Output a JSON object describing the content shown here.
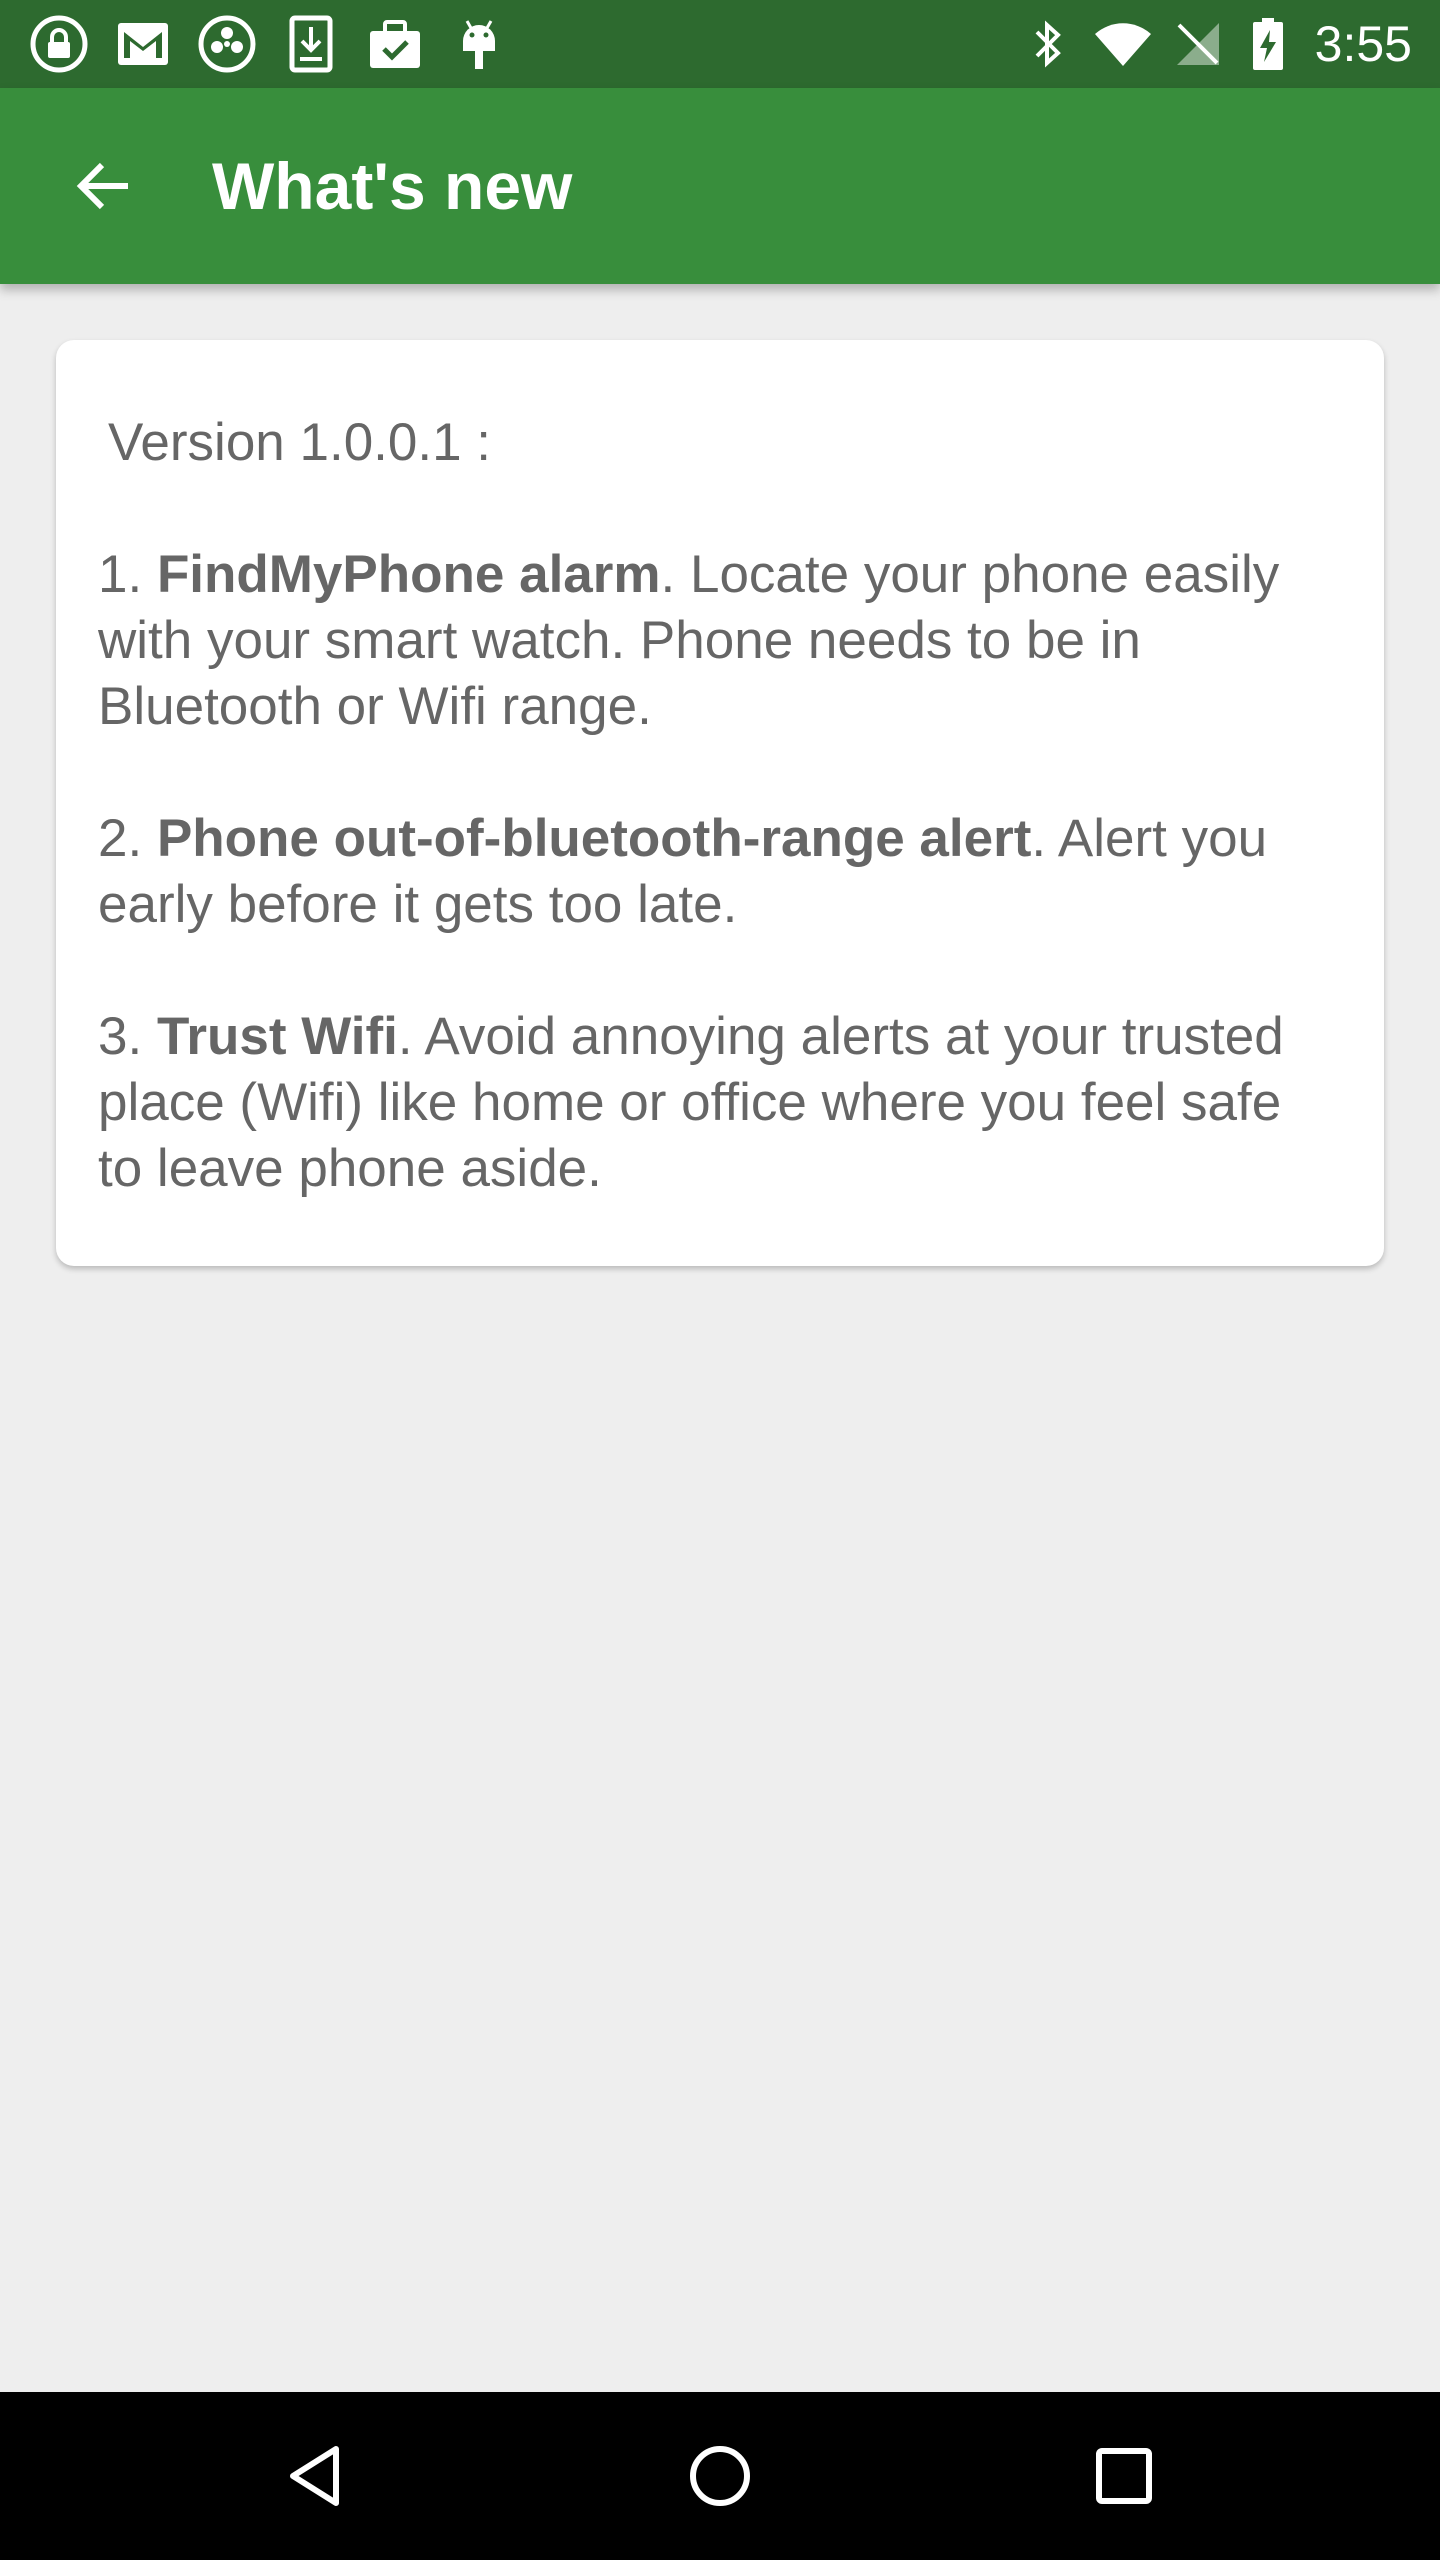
{
  "status_bar": {
    "time": "3:55",
    "left_icons": [
      "lock-icon",
      "gmail-icon",
      "app-icon",
      "download-icon",
      "clipboard-check-icon",
      "android-icon"
    ],
    "right_icons": [
      "bluetooth-icon",
      "wifi-icon",
      "no-sim-icon",
      "battery-charging-icon"
    ]
  },
  "app_bar": {
    "title": "What's new",
    "back_icon": "arrow-back-icon",
    "color": "#388e3c",
    "status_color": "#2d6a2f"
  },
  "content": {
    "version": "Version 1.0.0.1 :",
    "items": [
      {
        "number": "1. ",
        "title": "FindMyPhone alarm",
        "text": ". Locate your phone easily with your smart watch. Phone needs to be in Bluetooth or Wifi range."
      },
      {
        "number": "2. ",
        "title": "Phone out-of-bluetooth-range alert",
        "text": ". Alert you early before it gets too late."
      },
      {
        "number": "3. ",
        "title": "Trust Wifi",
        "text": ". Avoid annoying alerts at your trusted place (Wifi) like home or office where you feel safe to leave phone aside."
      }
    ]
  },
  "nav_bar": {
    "buttons": [
      "back-triangle-icon",
      "home-circle-icon",
      "recents-square-icon"
    ]
  }
}
